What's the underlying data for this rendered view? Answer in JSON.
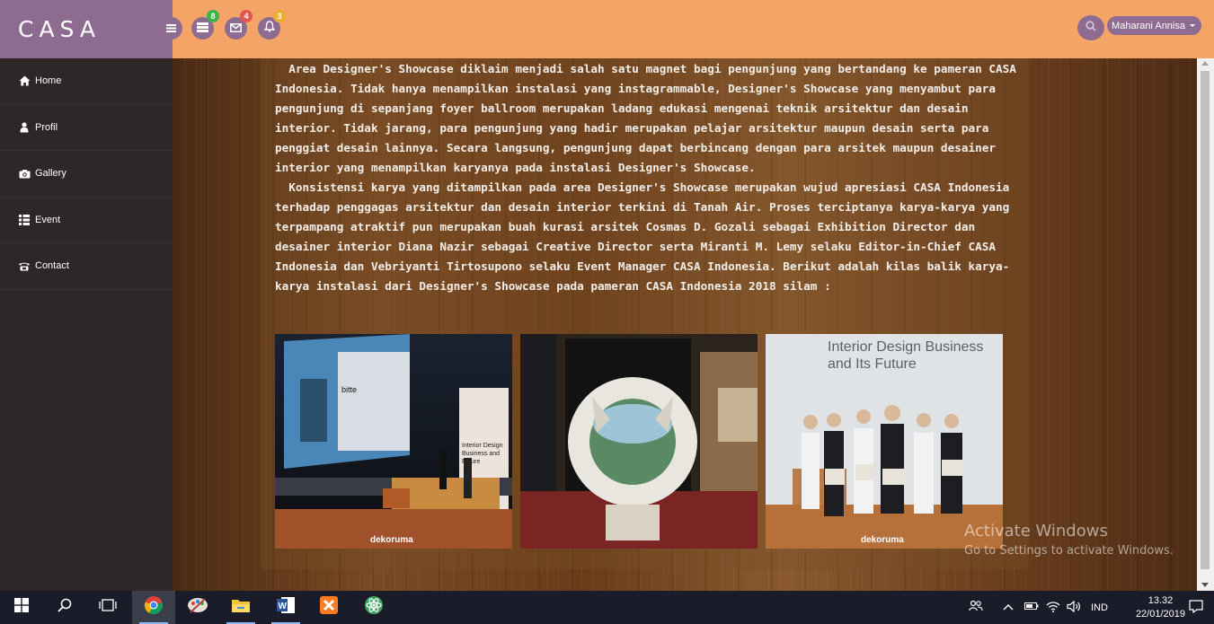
{
  "brand": "CASA",
  "header": {
    "menu_icon": "hamburger-icon",
    "badges": [
      {
        "icon": "tasks-icon",
        "count": "8",
        "color": "#39b54a"
      },
      {
        "icon": "envelope-icon",
        "count": "4",
        "color": "#e4574e"
      },
      {
        "icon": "bell-icon",
        "count": "3",
        "color": "#f0ad2e"
      }
    ],
    "user_name": "Maharani Annisa"
  },
  "sidebar": {
    "items": [
      {
        "label": "Home",
        "icon": "home-icon"
      },
      {
        "label": "Profil",
        "icon": "user-icon"
      },
      {
        "label": "Gallery",
        "icon": "camera-icon"
      },
      {
        "label": "Event",
        "icon": "grid-icon"
      },
      {
        "label": "Contact",
        "icon": "phone-icon"
      }
    ]
  },
  "article": {
    "paragraph_1": "Area Designer's Showcase diklaim menjadi salah satu magnet bagi pengunjung yang bertandang ke pameran CASA Indonesia. Tidak hanya menampilkan instalasi yang instagrammable, Designer's Showcase yang menyambut para pengunjung di sepanjang foyer ballroom merupakan ladang edukasi mengenai teknik arsitektur dan desain interior. Tidak jarang, para pengunjung yang hadir merupakan pelajar arsitektur maupun desain serta para penggiat desain lainnya. Secara langsung, pengunjung dapat berbincang dengan para arsitek maupun desainer interior yang menampilkan karyanya pada instalasi Designer's Showcase.",
    "paragraph_2": "Konsistensi karya yang ditampilkan pada area Designer's Showcase merupakan wujud apresiasi CASA Indonesia terhadap penggagas arsitektur dan desain interior terkini di Tanah Air. Proses terciptanya karya-karya yang terpampang atraktif pun merupakan buah kurasi arsitek Cosmas D. Gozali sebagai Exhibition Director dan desainer interior Diana Nazir sebagai Creative Director serta Miranti M. Lemy selaku Editor-in-Chief CASA Indonesia dan Vebriyanti Tirtosupono selaku Event Manager CASA Indonesia. Berikut adalah kilas balik karya-karya instalasi dari Designer's Showcase pada pameran CASA Indonesia 2018 silam :"
  },
  "photos": {
    "p1_slide": "bitte",
    "p1_banner": "Interior Design Business and Future",
    "p1_caption": "dekoruma",
    "p3_title": "Interior Design Business and Its Future",
    "p3_caption": "dekoruma"
  },
  "watermark": {
    "line1": "Activate Windows",
    "line2": "Go to Settings to activate Windows."
  },
  "taskbar": {
    "language": "IND",
    "time": "13.32",
    "date": "22/01/2019"
  }
}
